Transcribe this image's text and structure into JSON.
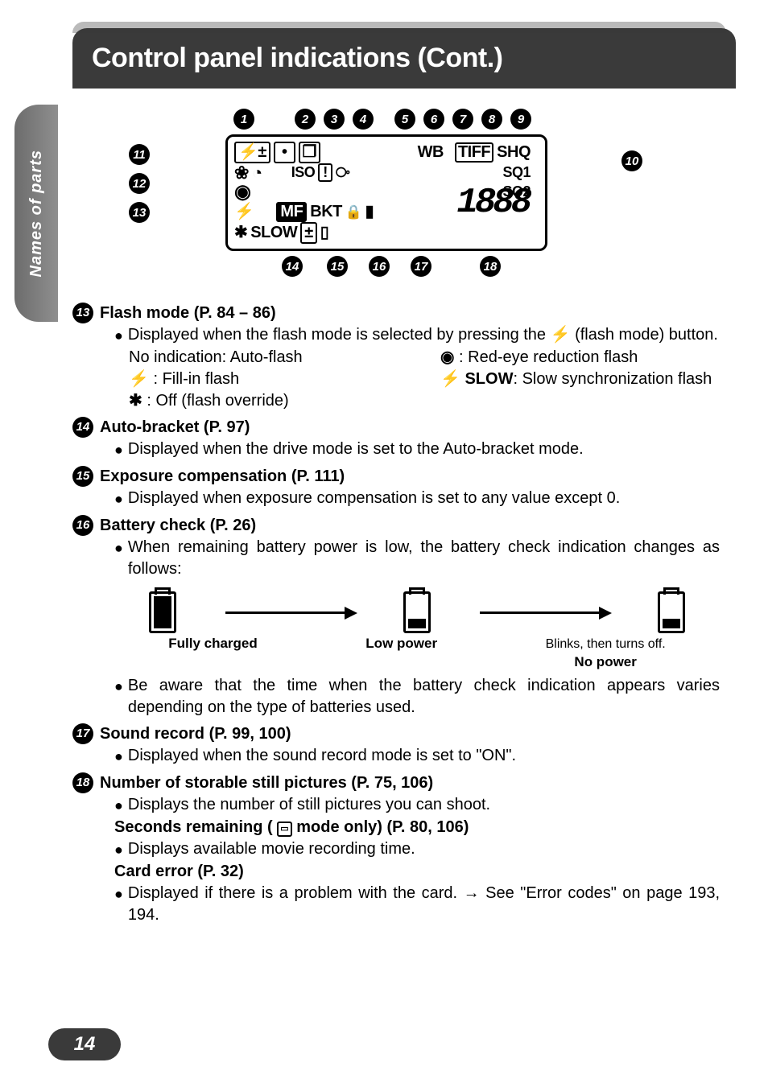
{
  "header": {
    "title": "Control panel indications (Cont.)"
  },
  "side_tab": "Names of parts",
  "page_number": "14",
  "callouts_top": [
    "1",
    "2",
    "3",
    "4",
    "5",
    "6",
    "7",
    "8",
    "9"
  ],
  "callouts_left": [
    "11",
    "12",
    "13"
  ],
  "callout_right": "10",
  "callouts_bottom": [
    "14",
    "15",
    "16",
    "17",
    "18"
  ],
  "lcd": {
    "row1": {
      "wb": "WB",
      "tiff": "TIFF",
      "shq": "SHQ"
    },
    "row2": {
      "iso": "ISO",
      "bang": "!",
      "sq1": "SQ1"
    },
    "row3": {
      "sq2": "SQ2"
    },
    "row4": {
      "mf": "MF",
      "bkt": "BKT"
    },
    "row5": {
      "slow": "SLOW"
    },
    "seg": "1888"
  },
  "items": {
    "i13": {
      "num": "13",
      "title": "Flash mode (P. 84 – 86)",
      "line1a": "Displayed when the flash mode is selected by pressing the ",
      "line1b": " (flash mode) button.",
      "c1a": "No indication: Auto-flash",
      "c1b": " : Fill-in flash",
      "c1c": " : Off (flash override)",
      "c2a": " : Red-eye reduction flash",
      "c2b_pre": " ",
      "c2b_slow": "SLOW",
      "c2b_post": ": Slow synchronization flash"
    },
    "i14": {
      "num": "14",
      "title": "Auto-bracket (P. 97)",
      "line1": "Displayed when the drive mode is set to the Auto-bracket mode."
    },
    "i15": {
      "num": "15",
      "title": "Exposure compensation (P. 111)",
      "line1": "Displayed when exposure compensation is set to any value except 0."
    },
    "i16": {
      "num": "16",
      "title": "Battery check (P. 26)",
      "line1": "When remaining battery power is low, the battery check indication changes as follows:",
      "labels": {
        "full": "Fully charged",
        "low": "Low power",
        "none1": "Blinks, then turns off.",
        "none2": "No power"
      },
      "line2": "Be aware that the time when the battery check indication appears varies depending on the type of batteries used."
    },
    "i17": {
      "num": "17",
      "title": "Sound record (P. 99, 100)",
      "line1": "Displayed when the sound record mode is set to \"ON\"."
    },
    "i18": {
      "num": "18",
      "title1": "Number of storable still pictures (P. 75, 106)",
      "line1": "Displays the number of still pictures you can shoot.",
      "title2a": "Seconds remaining (",
      "title2b": " mode only) (P. 80, 106)",
      "line2": "Displays available movie recording time.",
      "title3": "Card error (P. 32)",
      "line3a": "Displayed if there is a problem with the card. ",
      "line3b": " See \"Error codes\" on page 193, 194."
    }
  },
  "icons": {
    "flash": "⚡",
    "flash_off": "✱",
    "redeye": "◉",
    "timer": "⏲",
    "camera": "📷",
    "arrow": "→",
    "movie": "⌬",
    "spot": "•",
    "multi": "▦",
    "expcomp": "⧃",
    "sound": "🎤",
    "batt": "▮"
  }
}
